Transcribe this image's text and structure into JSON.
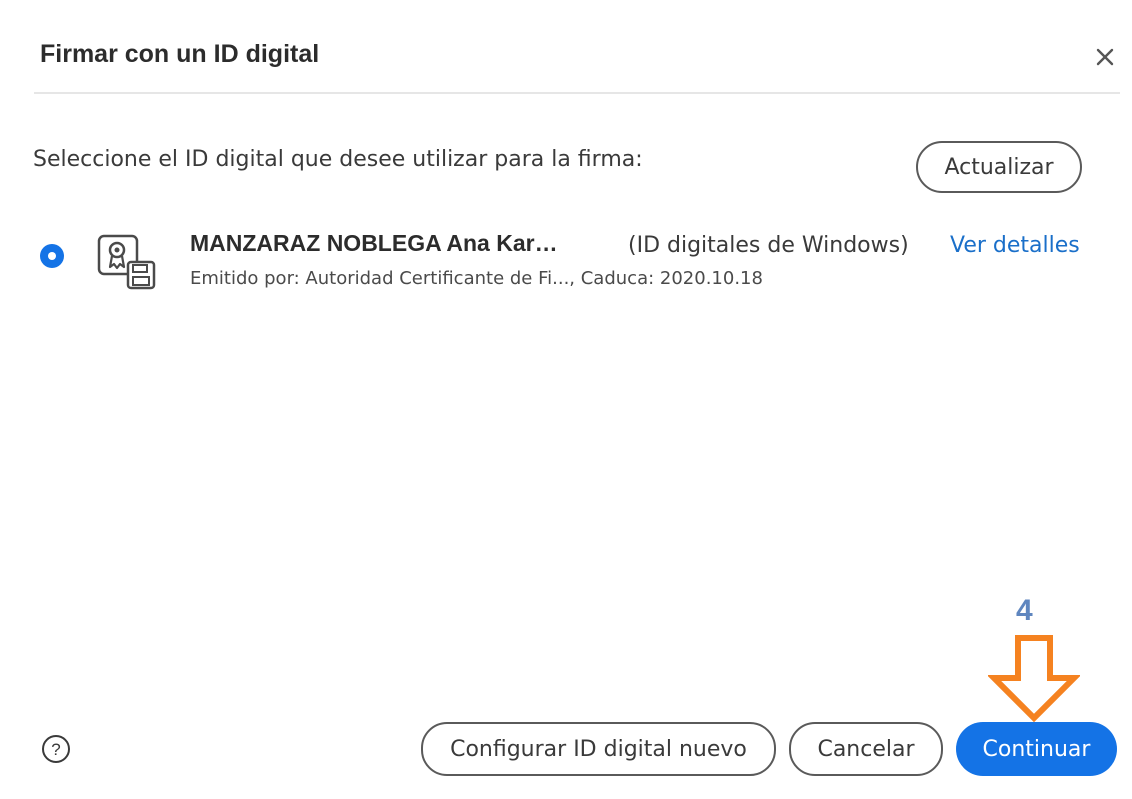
{
  "dialog": {
    "title": "Firmar con un ID digital",
    "close_icon": "close-icon"
  },
  "main": {
    "prompt": "Seleccione el ID digital que desee utilizar para la firma:",
    "refresh_label": "Actualizar",
    "digital_id": {
      "selected": true,
      "icon": "certificate-icon",
      "name": "MANZARAZ NOBLEGA Ana Kar…",
      "source": "(ID digitales de Windows)",
      "details_link": "Ver detalles",
      "issuer_line": "Emitido por: Autoridad Certificante de Fi..., Caduca: 2020.10.18"
    }
  },
  "footer": {
    "help_icon": "help-icon",
    "new_id_label": "Configurar ID digital nuevo",
    "cancel_label": "Cancelar",
    "continue_label": "Continuar"
  },
  "annotation": {
    "step_number": "4",
    "arrow_icon": "down-arrow-icon"
  },
  "colors": {
    "accent": "#1473e6",
    "link": "#1a6fc9",
    "annotation_arrow": "#f58220",
    "annotation_number": "#5f86bf"
  }
}
